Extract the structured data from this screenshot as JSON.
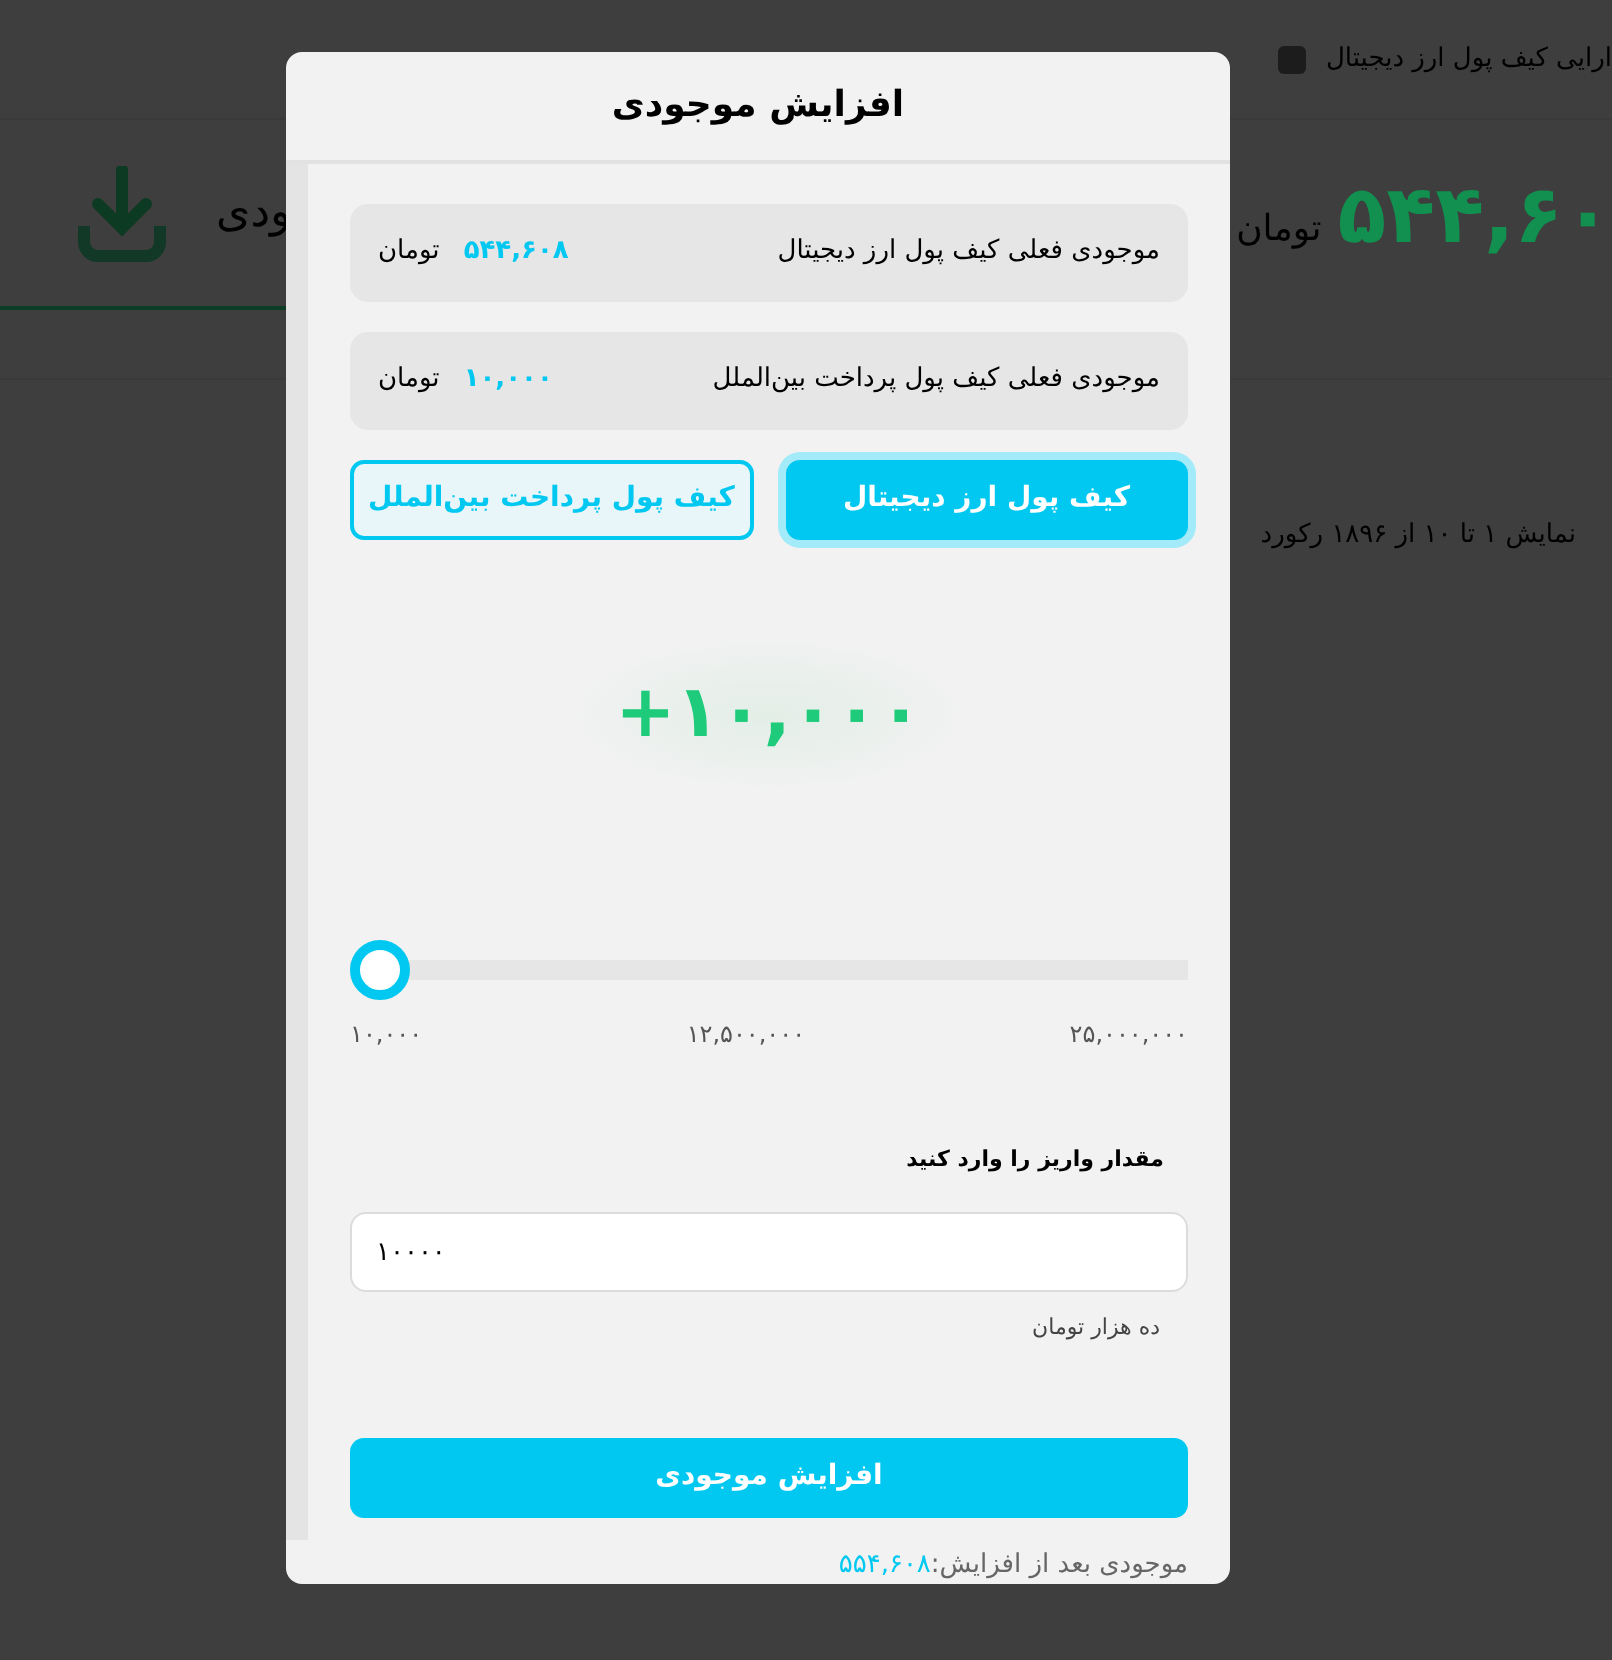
{
  "background": {
    "header_text": "ارایی کیف پول ارز دیجیتال",
    "card_label": "ودی",
    "balance_amount": "۵۴۴,۶۰",
    "balance_unit": "تومان",
    "records_info": "نمایش ۱ تا ۱۰ از ۱۸۹۶ رکورد"
  },
  "modal": {
    "title": "افزایش موجودی",
    "balances": [
      {
        "label": "موجودی فعلی کیف پول ارز دیجیتال",
        "amount": "۵۴۴,۶۰۸",
        "unit": "تومان"
      },
      {
        "label": "موجودی فعلی کیف پول پرداخت بین‌الملل",
        "amount": "۱۰,۰۰۰",
        "unit": "تومان"
      }
    ],
    "wallets": [
      {
        "label": "کیف پول ارز دیجیتال",
        "selected": true
      },
      {
        "label": "کیف پول پرداخت بین‌الملل",
        "selected": false
      }
    ],
    "amount_display": "+۱۰,۰۰۰",
    "slider": {
      "level": 0,
      "ticks": [
        "۲۵,۰۰۰,۰۰۰",
        "۱۲,۵۰۰,۰۰۰",
        "۱۰,۰۰۰"
      ]
    },
    "input": {
      "label": "مقدار واریز را وارد کنید",
      "value": "۱۰۰۰۰",
      "hint": "ده هزار تومان"
    },
    "submit": "افزایش موجودی",
    "after": {
      "label": "موجودی بعد از افزایش:",
      "amount": "۵۵۴,۶۰۸"
    }
  }
}
